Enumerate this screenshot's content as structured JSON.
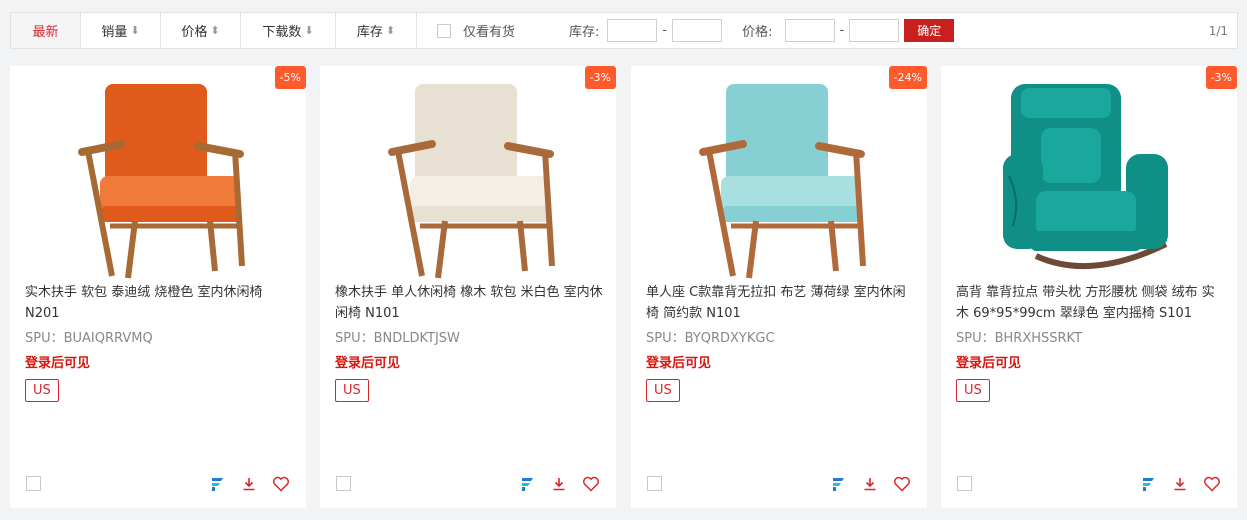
{
  "filters": {
    "sorts": [
      {
        "label": "最新",
        "arrow": "",
        "active": true
      },
      {
        "label": "销量",
        "arrow": "⬇",
        "active": false
      },
      {
        "label": "价格",
        "arrow": "⬍",
        "active": false
      },
      {
        "label": "下载数",
        "arrow": "⬇",
        "active": false
      },
      {
        "label": "库存",
        "arrow": "⬍",
        "active": false
      }
    ],
    "stock_only_label": "仅看有货",
    "stock_label": "库存:",
    "price_label": "价格:",
    "confirm_label": "确定",
    "page": "1/1"
  },
  "products": [
    {
      "discount": "-5%",
      "title": "实木扶手 软包 泰迪绒 烧橙色 室内休闲椅 N201",
      "spu": "SPU：BUAIQRRVMQ",
      "login_text": "登录后可见",
      "region": "US",
      "chair_color": "#e05a1c",
      "chair_light": "#f07a3a",
      "frame_color": "#a86a34",
      "style": "armchair"
    },
    {
      "discount": "-3%",
      "title": "橡木扶手 单人休闲椅 橡木 软包 米白色 室内休闲椅 N101",
      "spu": "SPU：BNDLDKTJSW",
      "login_text": "登录后可见",
      "region": "US",
      "chair_color": "#e8e0d2",
      "chair_light": "#f4eee4",
      "frame_color": "#a96a3b",
      "style": "armchair"
    },
    {
      "discount": "-24%",
      "title": "单人座 C款靠背无拉扣 布艺 薄荷绿 室内休闲椅 简约款 N101",
      "spu": "SPU：BYQRDXYKGC",
      "login_text": "登录后可见",
      "region": "US",
      "chair_color": "#86cfd3",
      "chair_light": "#a8e0e2",
      "frame_color": "#b06a3a",
      "style": "armchair"
    },
    {
      "discount": "-3%",
      "title": "高背 靠背拉点 带头枕 方形腰枕 侧袋 绒布 实木 69*95*99cm 翠绿色 室内摇椅 S101",
      "spu": "SPU：BHRXHSSRKT",
      "login_text": "登录后可见",
      "region": "US",
      "chair_color": "#0f8f85",
      "chair_light": "#1aa89d",
      "frame_color": "#6b4a36",
      "style": "rocker"
    }
  ],
  "icons": {
    "brand": "brand-f-icon",
    "download": "download-icon",
    "favorite": "heart-icon",
    "accent": "#d9272e",
    "brand_blue": "#1e7bd8",
    "brand_teal": "#20c2c8"
  }
}
